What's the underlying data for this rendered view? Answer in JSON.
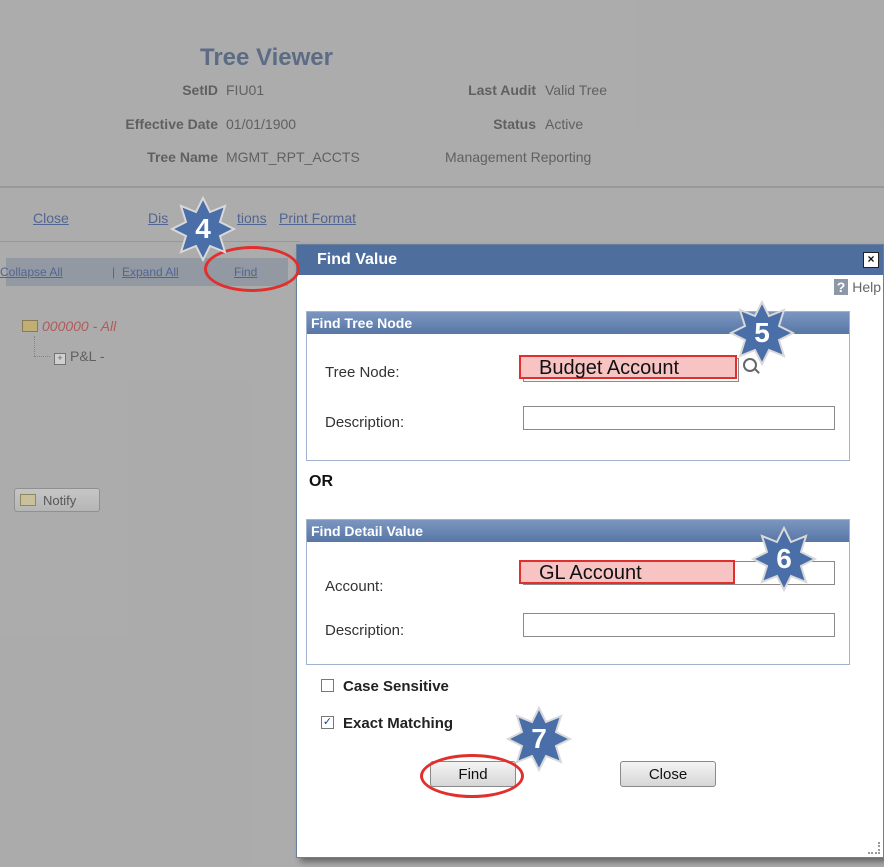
{
  "tree_viewer": {
    "title": "Tree Viewer",
    "setid_label": "SetID",
    "setid_value": "FIU01",
    "last_audit_label": "Last Audit",
    "last_audit_value": "Valid Tree",
    "effective_date_label": "Effective Date",
    "effective_date_value": "01/01/1900",
    "status_label": "Status",
    "status_value": "Active",
    "tree_name_label": "Tree Name",
    "tree_name_value": "MGMT_RPT_ACCTS",
    "tree_description": "Management Reporting"
  },
  "links": {
    "close": "Close",
    "display_options_part1": "Dis",
    "display_options_part2": "tions",
    "print_format": "Print Format",
    "collapse_all": "Collapse All",
    "separator": "|",
    "expand_all": "Expand All",
    "find": "Find"
  },
  "tree": {
    "root": "000000 - All",
    "child": "P&L -"
  },
  "notify_button": "Notify",
  "dialog": {
    "title": "Find Value",
    "close_glyph": "×",
    "help_q": "?",
    "help_label": "Help",
    "find_tree_node": {
      "header": "Find Tree Node",
      "tree_node_label": "Tree Node:",
      "tree_node_value": "Budget Account",
      "description_label": "Description:"
    },
    "or_label": "OR",
    "find_detail_value": {
      "header": "Find Detail Value",
      "account_label": "Account:",
      "account_value": "GL Account",
      "description_label": "Description:"
    },
    "case_sensitive_label": "Case Sensitive",
    "case_sensitive_checked": false,
    "exact_matching_label": "Exact Matching",
    "exact_matching_checked": true,
    "check_glyph": "✓",
    "find_button": "Find",
    "close_button": "Close"
  },
  "callouts": {
    "step4": "4",
    "step5": "5",
    "step6": "6",
    "step7": "7",
    "color": "#4a6ea8",
    "highlight_color": "#e0302e"
  }
}
